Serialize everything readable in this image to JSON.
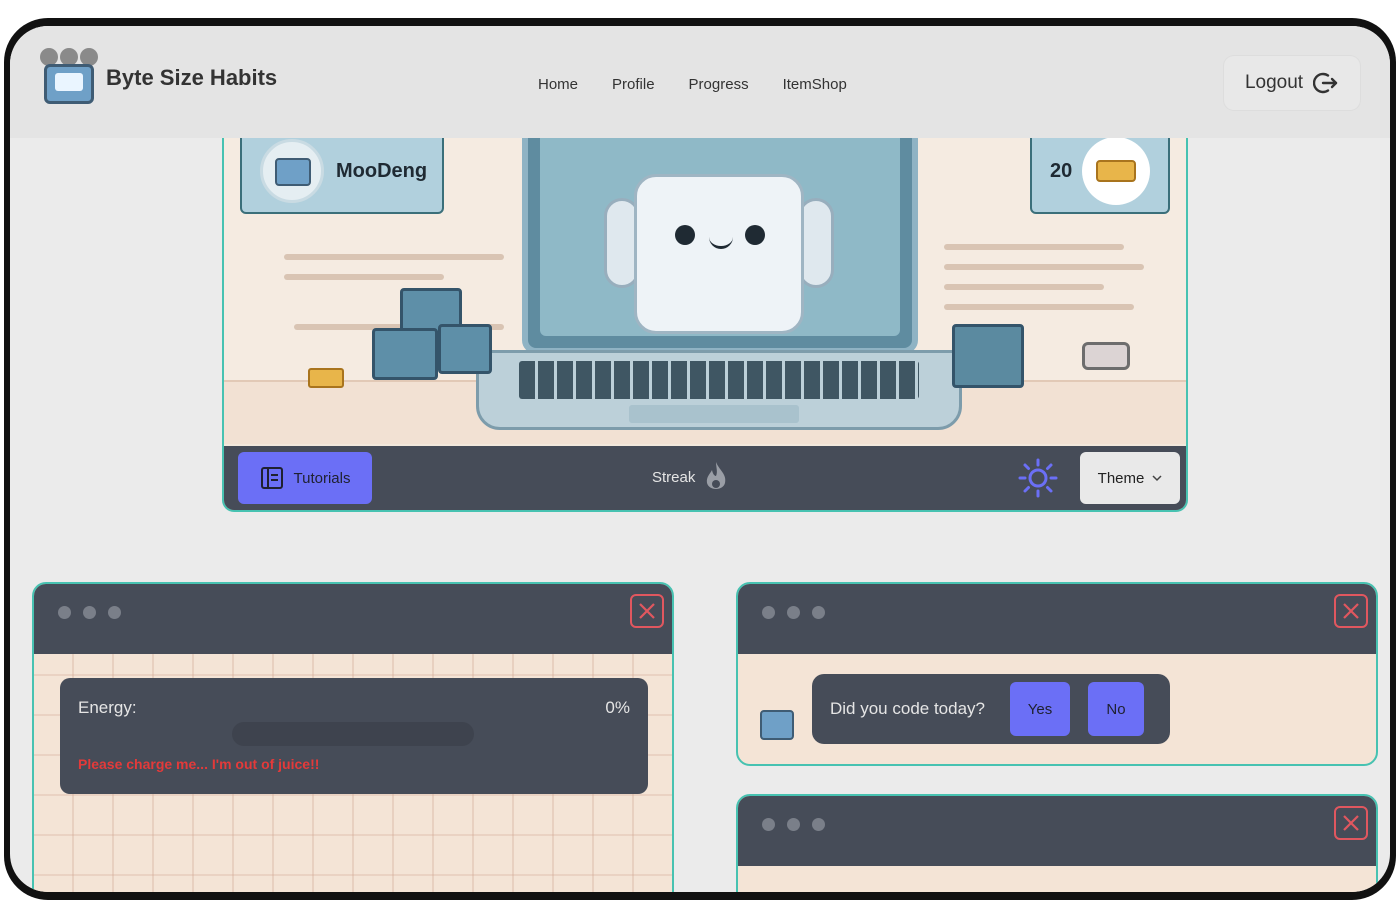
{
  "app": {
    "name": "Byte Size Habits"
  },
  "nav": {
    "links": [
      "Home",
      "Profile",
      "Progress",
      "ItemShop"
    ],
    "logout_label": "Logout"
  },
  "hero": {
    "username": "MooDeng",
    "coins": "20",
    "tutorials_label": "Tutorials",
    "streak_label": "Streak",
    "theme_label": "Theme"
  },
  "energy_widget": {
    "label": "Energy:",
    "percent_text": "0%",
    "level": 0,
    "message": "Please charge me... I'm out of juice!!"
  },
  "code_widget": {
    "question": "Did you code today?",
    "yes_label": "Yes",
    "no_label": "No"
  },
  "colors": {
    "accent": "#6b6ff6",
    "border": "#47c2b1",
    "panel": "#464c58",
    "warning": "#e33a3a"
  },
  "icons": [
    "robot-logo-icon",
    "logout-icon",
    "tutorials-book-icon",
    "flame-icon",
    "sun-icon",
    "chevron-down-icon",
    "close-icon",
    "coin-stack-icon"
  ]
}
